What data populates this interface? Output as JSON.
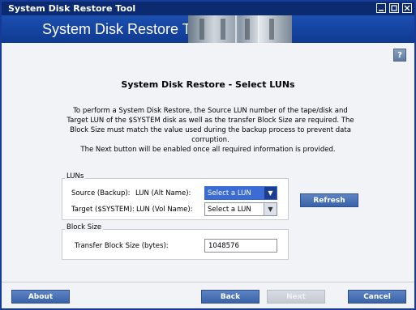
{
  "window": {
    "title": "System Disk Restore Tool",
    "min_icon": "minimize-icon",
    "max_icon": "maximize-icon",
    "close_icon": "close-icon"
  },
  "banner": {
    "title": "System Disk Restore Tool"
  },
  "help": {
    "label": "?"
  },
  "page": {
    "heading": "System Disk Restore - Select LUNs",
    "description": "To perform a System Disk Restore, the Source LUN number of the tape/disk and Target LUN of the $SYSTEM disk as well as the transfer Block Size are required. The Block Size must match the value used during the backup process to prevent data corruption.",
    "note": "The Next button will be enabled once all required information is provided."
  },
  "luns": {
    "group_label": "LUNs",
    "source_label": "Source (Backup):",
    "source_sub": "LUN (Alt Name):",
    "source_value": "Select a LUN",
    "target_label": "Target ($SYSTEM):",
    "target_sub": "LUN (Vol Name):",
    "target_value": "Select a LUN",
    "refresh_label": "Refresh"
  },
  "block": {
    "group_label": "Block Size",
    "transfer_label": "Transfer Block Size (bytes):",
    "transfer_value": "1048576"
  },
  "footer": {
    "about": "About",
    "back": "Back",
    "next": "Next",
    "cancel": "Cancel"
  },
  "colors": {
    "titlebar": "#0b2a6f",
    "banner": "#1b4fb0",
    "button": "#4a74ba",
    "selected": "#3b6bd5"
  }
}
